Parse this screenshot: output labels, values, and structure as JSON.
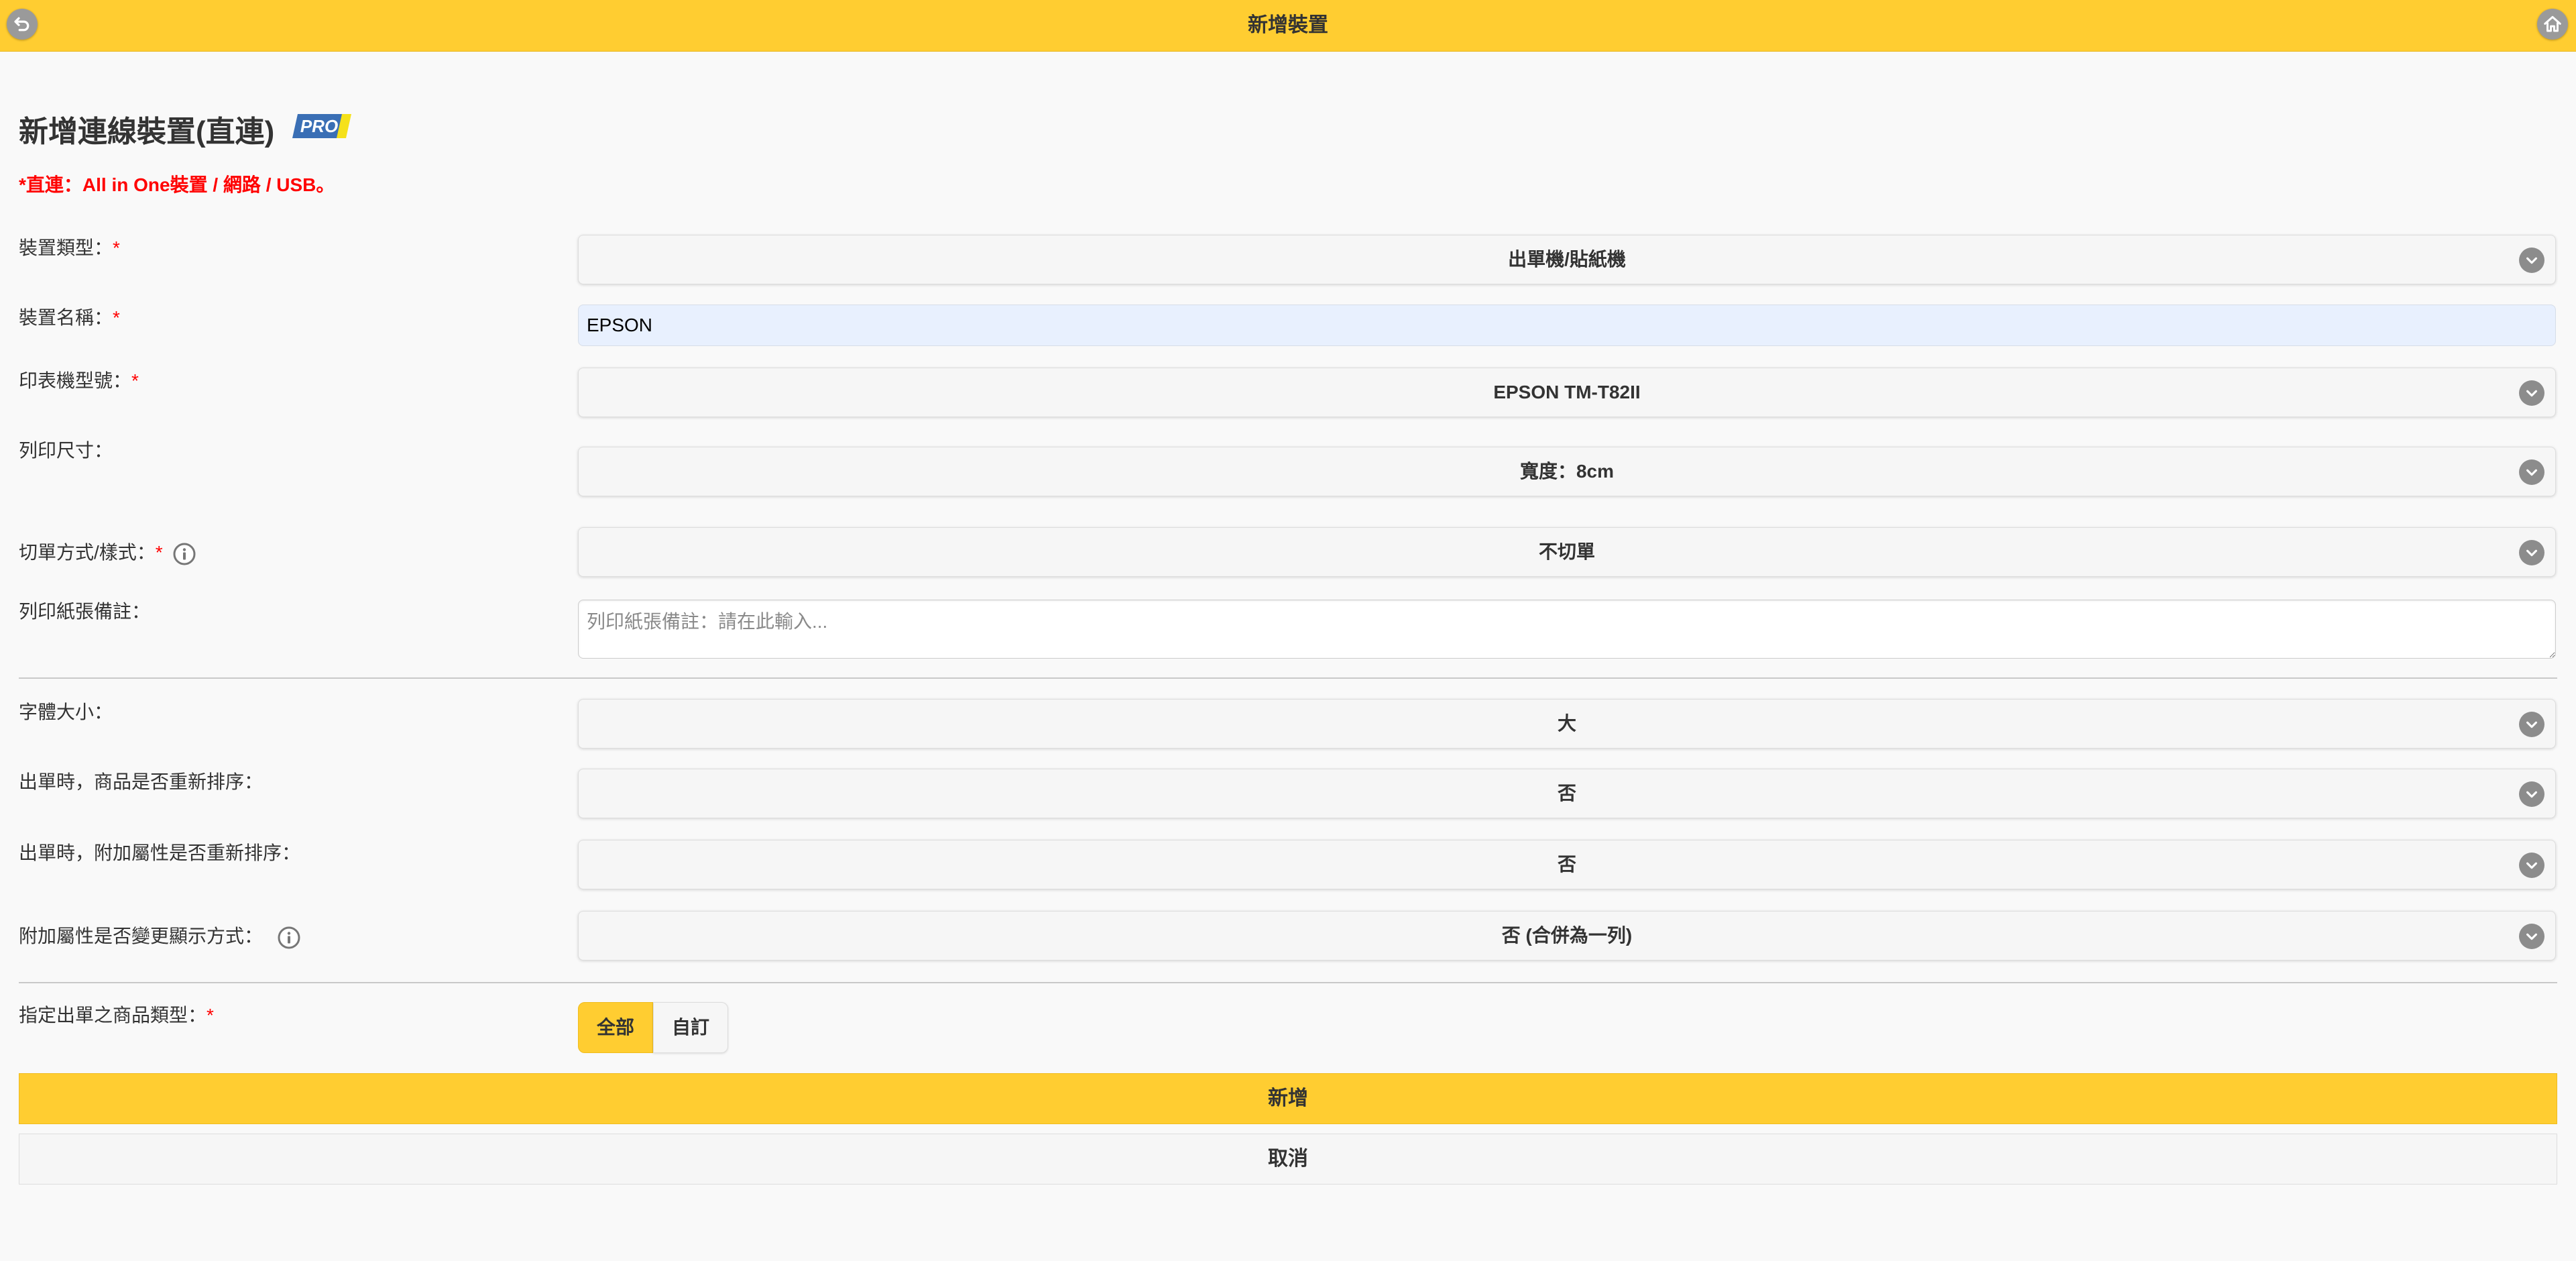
{
  "header": {
    "title": "新增裝置",
    "back_icon": "back-arrow-icon",
    "home_icon": "home-icon",
    "bar_color": "#ffcd31"
  },
  "page": {
    "heading": "新增連線裝置(直連)",
    "badge": "PRO",
    "notice": "*直連：All in One裝置 / 網路 / USB。",
    "required_mark": "*",
    "accent_color": "#ffcd31",
    "required_color": "#ff0000"
  },
  "form": {
    "device_type": {
      "label": "裝置類型：",
      "value": "出單機/貼紙機"
    },
    "device_name": {
      "label": "裝置名稱：",
      "value": "EPSON"
    },
    "printer_model": {
      "label": "印表機型號：",
      "value": "EPSON TM-T82II"
    },
    "print_size": {
      "label": "列印尺寸：",
      "value": "寬度：8cm"
    },
    "cut_mode": {
      "label": "切單方式/樣式：",
      "value": "不切單",
      "info_icon": "info-icon"
    },
    "paper_note": {
      "label": "列印紙張備註：",
      "placeholder": "列印紙張備註：請在此輸入..."
    },
    "font_size": {
      "label": "字體大小：",
      "value": "大"
    },
    "resort_items": {
      "label": "出單時，商品是否重新排序：",
      "value": "否"
    },
    "resort_attrs": {
      "label": "出單時，附加屬性是否重新排序：",
      "value": "否"
    },
    "attr_display": {
      "label": "附加屬性是否變更顯示方式：",
      "value": "否 (合併為一列)",
      "info_icon": "info-icon"
    },
    "product_type": {
      "label": "指定出單之商品類型：",
      "options": [
        "全部",
        "自訂"
      ],
      "selected": "全部"
    }
  },
  "actions": {
    "submit_label": "新增",
    "cancel_label": "取消"
  }
}
